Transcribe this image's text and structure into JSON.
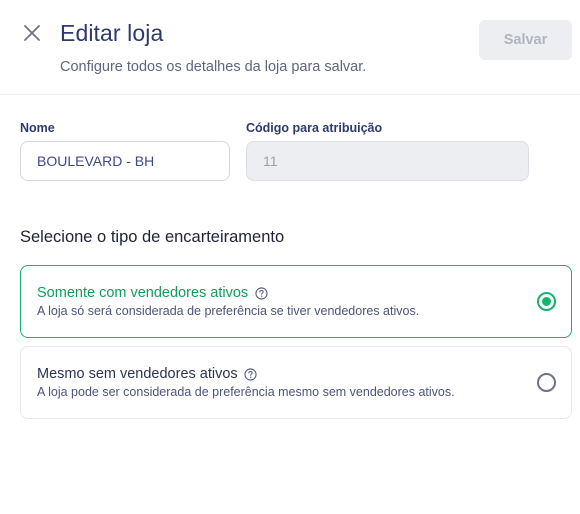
{
  "header": {
    "title": "Editar loja",
    "subtitle": "Configure todos os detalhes da loja para salvar.",
    "save_label": "Salvar",
    "close_icon": "close-icon"
  },
  "form": {
    "nome_label": "Nome",
    "nome_value": "BOULEVARD - BH",
    "codigo_label": "Código para atribuição",
    "codigo_value": "11"
  },
  "encarteiramento": {
    "section_title": "Selecione o tipo de encarteiramento",
    "options": [
      {
        "title": "Somente com vendedores ativos",
        "description": "A loja só será considerada de preferência se tiver vendedores ativos.",
        "selected": true
      },
      {
        "title": "Mesmo sem vendedores ativos",
        "description": "A loja pode ser considerada de preferência mesmo sem vendedores ativos.",
        "selected": false
      }
    ]
  },
  "colors": {
    "accent_green": "#14b36e",
    "title_navy": "#2e3a6b",
    "disabled_bg": "#edeef1"
  }
}
